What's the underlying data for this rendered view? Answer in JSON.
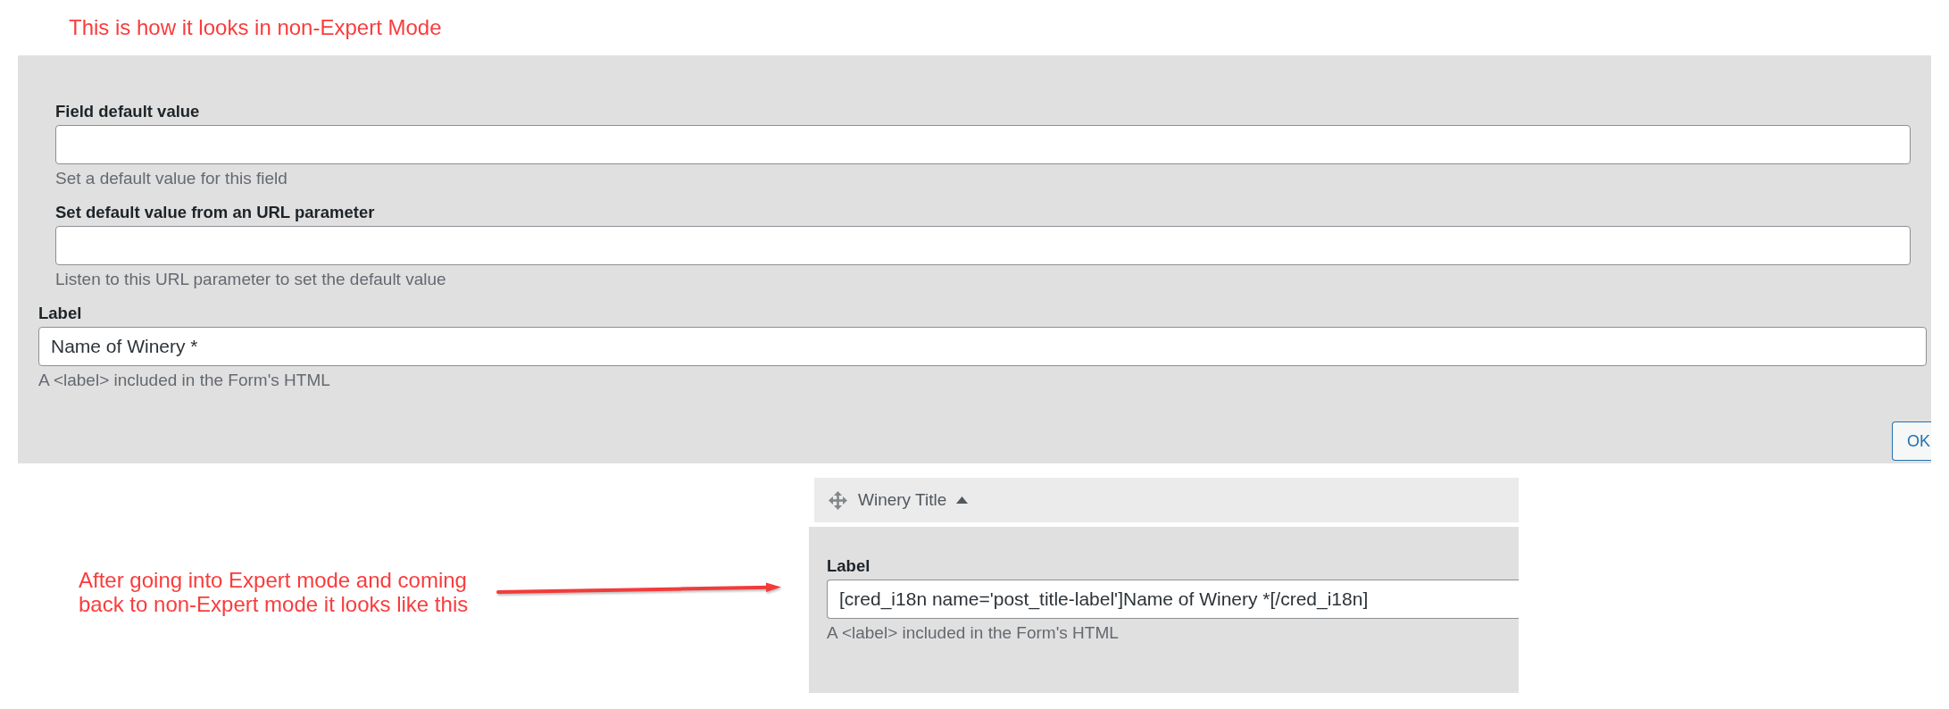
{
  "top_note": {
    "text": "This is how it looks in non-Expert Mode"
  },
  "settings_panel": {
    "default_value_fields": [
      {
        "label": "Field default value",
        "description": "Set a default value for this field"
      },
      {
        "label": "Set default value from an URL parameter",
        "description": "Listen to this URL parameter to set the default value"
      }
    ],
    "label_field": {
      "label": "Label",
      "value": "Name of Winery *",
      "description": "A <label> included in the Form's HTML"
    },
    "ok_button": {
      "label": "OK"
    }
  },
  "bottom_note": {
    "text": "After going into Expert mode and coming back to non-Expert mode it looks like this"
  },
  "field_card": {
    "title": "Winery Title",
    "expanded": true,
    "label_field": {
      "label": "Label",
      "value": "[cred_i18n name='post_title-label']Name of Winery *[/cred_i18n]",
      "description": "A <label> included in the Form's HTML"
    }
  }
}
